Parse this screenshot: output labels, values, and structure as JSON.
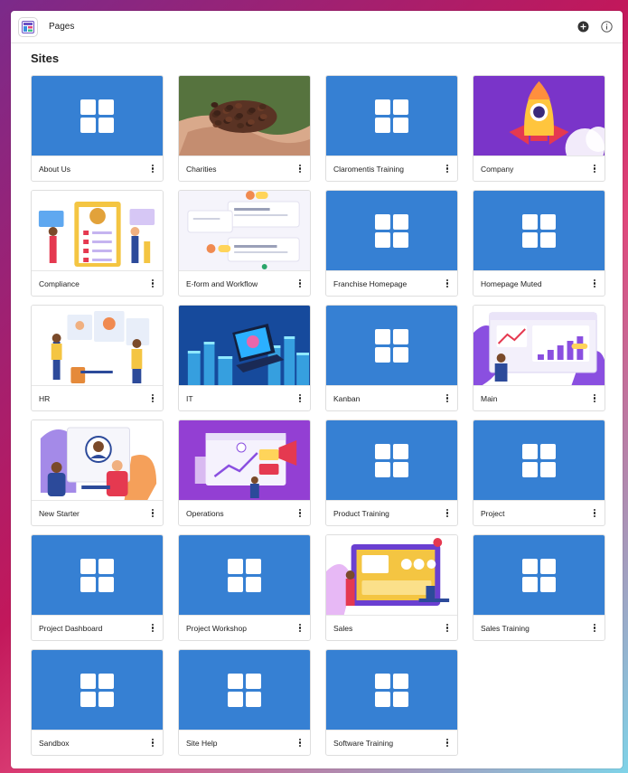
{
  "app": {
    "title": "Pages"
  },
  "section": {
    "heading": "Sites"
  },
  "colors": {
    "tile_blue": "#3680d3",
    "accent": "#c2185b"
  },
  "sites": [
    {
      "label": "About Us",
      "thumb": "grid-icon"
    },
    {
      "label": "Charities",
      "thumb": "beans-photo"
    },
    {
      "label": "Claromentis Training",
      "thumb": "grid-icon"
    },
    {
      "label": "Company",
      "thumb": "rocket-illustration"
    },
    {
      "label": "Compliance",
      "thumb": "compliance-illustration"
    },
    {
      "label": "E-form and Workflow",
      "thumb": "workflow-illustration"
    },
    {
      "label": "Franchise Homepage",
      "thumb": "grid-icon"
    },
    {
      "label": "Homepage Muted",
      "thumb": "grid-icon"
    },
    {
      "label": "HR",
      "thumb": "hr-illustration"
    },
    {
      "label": "IT",
      "thumb": "it-illustration"
    },
    {
      "label": "Kanban",
      "thumb": "grid-icon"
    },
    {
      "label": "Main",
      "thumb": "main-illustration"
    },
    {
      "label": "New Starter",
      "thumb": "newstarter-illustration"
    },
    {
      "label": "Operations",
      "thumb": "operations-illustration"
    },
    {
      "label": "Product Training",
      "thumb": "grid-icon"
    },
    {
      "label": "Project",
      "thumb": "grid-icon"
    },
    {
      "label": "Project Dashboard",
      "thumb": "grid-icon"
    },
    {
      "label": "Project Workshop",
      "thumb": "grid-icon"
    },
    {
      "label": "Sales",
      "thumb": "sales-illustration"
    },
    {
      "label": "Sales Training",
      "thumb": "grid-icon"
    },
    {
      "label": "Sandbox",
      "thumb": "grid-icon"
    },
    {
      "label": "Site Help",
      "thumb": "grid-icon"
    },
    {
      "label": "Software Training",
      "thumb": "grid-icon"
    }
  ]
}
